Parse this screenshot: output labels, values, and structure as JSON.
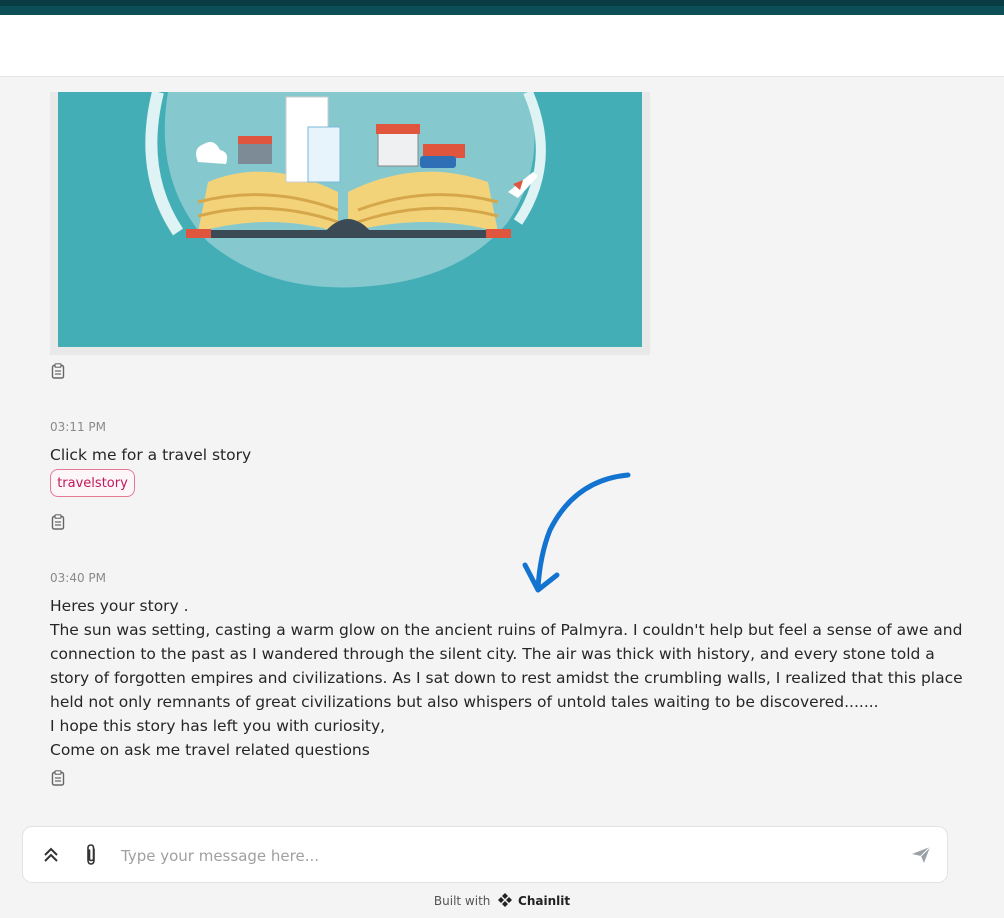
{
  "messages": [
    {
      "time": "03:11 PM",
      "text": "Click me for a travel story",
      "tag": "travelstory"
    },
    {
      "time": "03:40 PM",
      "lines": [
        "Heres your story .",
        "The sun was setting, casting a warm glow on the ancient ruins of Palmyra. I couldn't help but feel a sense of awe and",
        "connection to the past as I wandered through the silent city. The air was thick with history, and every stone told a",
        "story of forgotten empires and civilizations. As I sat down to rest amidst the crumbling walls, I realized that this place",
        "held not only remnants of great civilizations but also whispers of untold tales waiting to be discovered.......",
        "I hope this story has left you with curiosity,",
        "Come on ask me travel related questions"
      ]
    }
  ],
  "composer": {
    "placeholder": "Type your message here..."
  },
  "footer": {
    "built_with": "Built with",
    "brand": "Chainlit"
  },
  "colors": {
    "topbar": "#0d4f57",
    "image_bg": "#44aeb7",
    "tag": "#c2185b",
    "arrow": "#1273d0"
  },
  "icons": [
    "clipboard-icon",
    "chevrons-up-icon",
    "paperclip-icon",
    "send-icon",
    "chainlit-logo-icon"
  ]
}
